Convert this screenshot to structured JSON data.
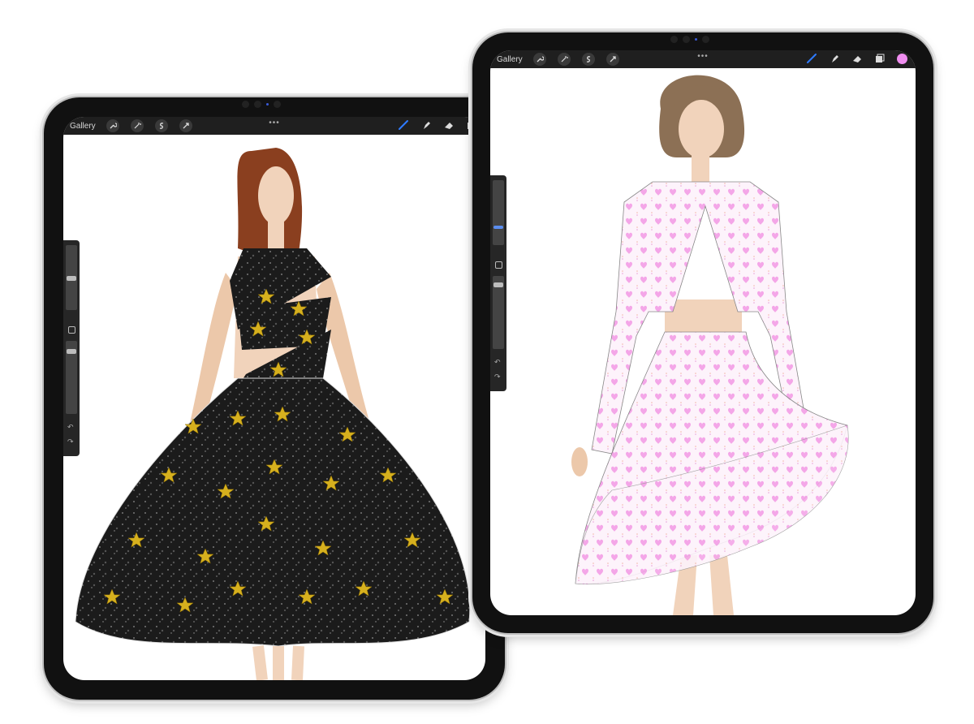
{
  "left_tablet": {
    "toolbar": {
      "gallery_label": "Gallery",
      "more_label": "•••"
    },
    "sidebar": {
      "undo": "↶",
      "redo": "↷"
    },
    "artwork": "black-star-dress-illustration"
  },
  "right_tablet": {
    "toolbar": {
      "gallery_label": "Gallery",
      "more_label": "•••"
    },
    "sidebar": {
      "undo": "↶",
      "redo": "↷"
    },
    "artwork": "pink-heart-suit-illustration",
    "active_color": "#f08ef0"
  },
  "colors": {
    "toolbar_bg": "#1f1f1f",
    "brush_active": "#2f7bff",
    "star_gold": "#d6b01e"
  },
  "icons": [
    "wrench-icon",
    "magic-wand-icon",
    "selection-icon",
    "move-icon",
    "brush-icon",
    "smudge-icon",
    "eraser-icon",
    "layers-icon",
    "color-icon"
  ]
}
